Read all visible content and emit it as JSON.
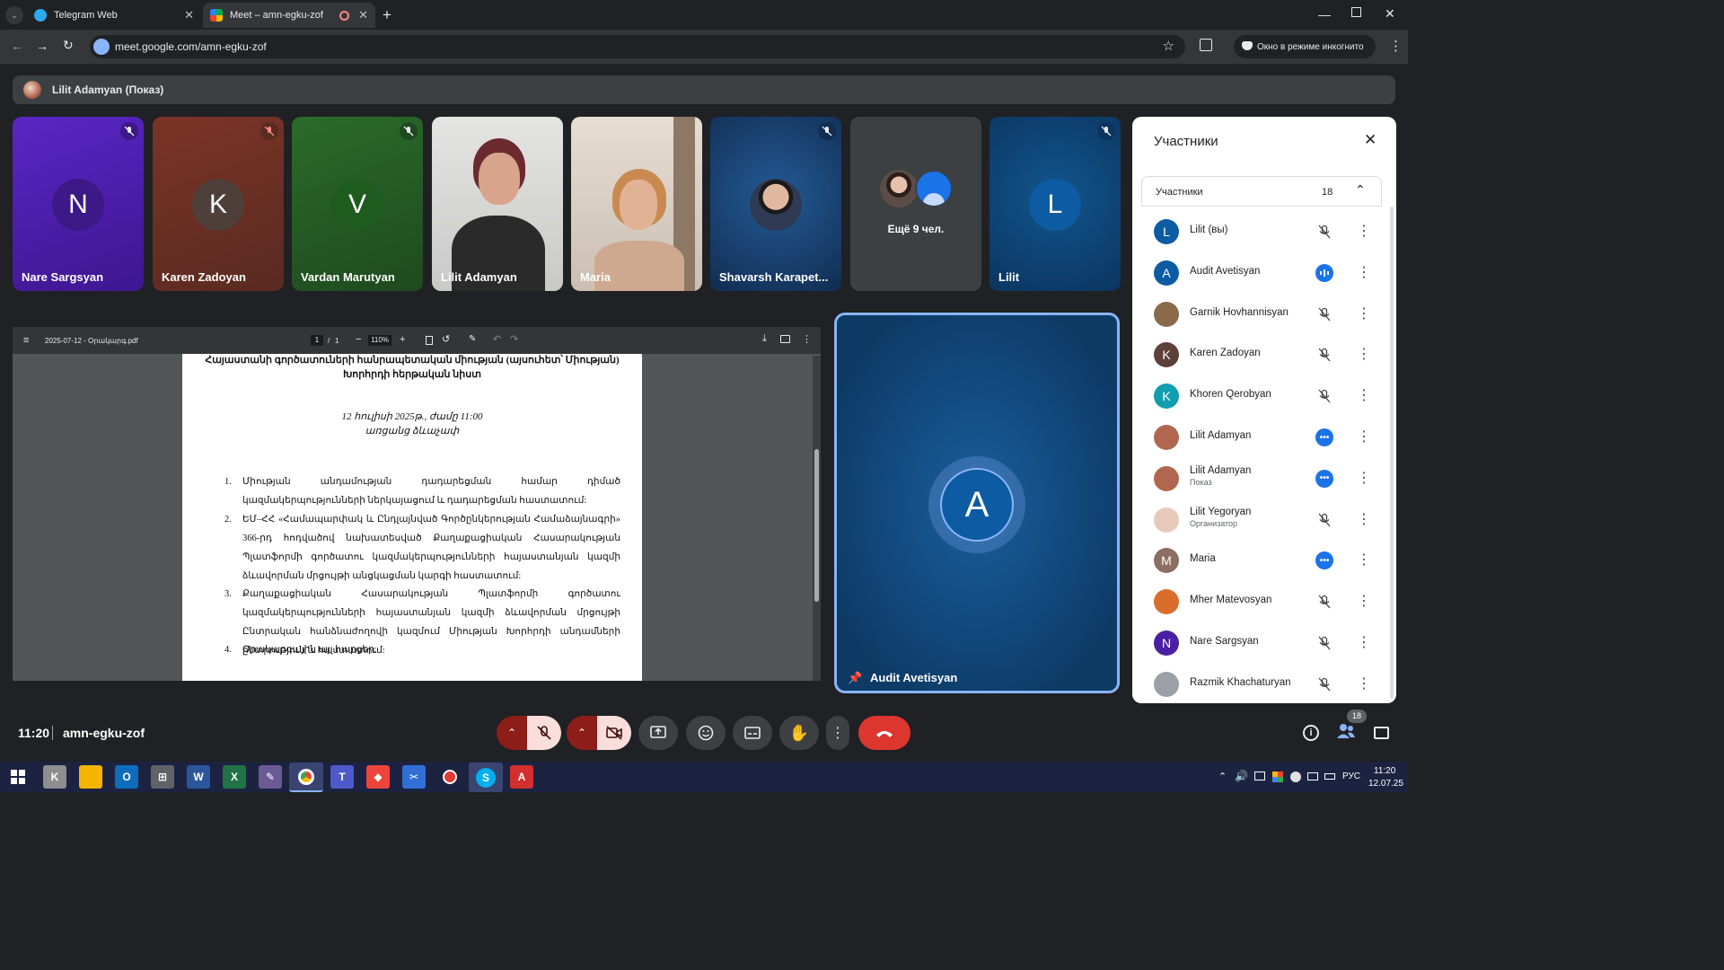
{
  "browser": {
    "tabs": [
      {
        "title": "Telegram Web",
        "active": false,
        "favicon_color": "#2aabee"
      },
      {
        "title": "Meet – amn-egku-zof",
        "active": true,
        "favicon_color": "#00ac47"
      }
    ],
    "url": "meet.google.com/amn-egku-zof",
    "incognito_label": "Окно в режиме инкогнито"
  },
  "meet": {
    "presenting_label": "Lilit Adamyan (Показ)",
    "tiles": [
      {
        "name": "Nare Sargsyan",
        "initial": "N",
        "bg": "#4b1fa3",
        "avatar_bg": "#3d1887",
        "muted": true
      },
      {
        "name": "Karen Zadoyan",
        "initial": "K",
        "bg": "#6b2e23",
        "avatar_bg": "#523c37",
        "muted": true
      },
      {
        "name": "Vardan Marutyan",
        "initial": "V",
        "bg": "#245524",
        "avatar_bg": "#1e5b1e",
        "muted": true
      },
      {
        "name": "Lilit Adamyan",
        "initial": "",
        "bg": "#cfcfcf",
        "avatar_bg": "",
        "muted": false,
        "video": true
      },
      {
        "name": "Maria",
        "initial": "",
        "bg": "#d8ccc2",
        "avatar_bg": "",
        "muted": false,
        "video": true
      },
      {
        "name": "Shavarsh Karapet...",
        "initial": "",
        "bg": "#173a66",
        "avatar_bg": "#2a2f3a",
        "muted": true
      },
      {
        "name": "",
        "initial": "",
        "bg": "#3c4043",
        "avatar_bg": "",
        "muted": false,
        "more": "Ещё 9 чел."
      },
      {
        "name": "Lilit",
        "initial": "L",
        "bg": "#0f4878",
        "avatar_bg": "#0c5ba3",
        "muted": true
      }
    ],
    "pinned": {
      "name": "Audit Avetisyan",
      "initial": "A"
    },
    "time": "11:20",
    "meeting_code": "amn-egku-zof",
    "participant_count": "18"
  },
  "pdf": {
    "filename": "2025-07-12 - Օրակարգ.pdf",
    "page_current": "1",
    "page_total": "1",
    "zoom": "110%",
    "heading_line1": "Հայաստանի գործատուների հանրապետական միության (այսուհետ՝ Միության)",
    "heading_line2": "Խորհրդի հերթական նիստ",
    "date_line": "12 հուլիսի 2025թ., ժամը 11:00",
    "place_line": "առցանց ձևաչափ",
    "items": [
      {
        "num": "1.",
        "text": "Միության անդամության դադարեցման համար դիմած կազմակերպությունների ներկայացում և դադարեցման հաստատում:"
      },
      {
        "num": "2.",
        "text": "ԵՄ–ՀՀ «Համապարփակ և Ընդլայնված Գործընկերության Համաձայնագրի» 366-րդ հոդվածով նախատեսված Քաղաքացիական Հասարակության Պլատֆորմի գործատու կազմակերպությունների հայաստանյան կազմի ձևավորման մրցույթի անցկացման կարգի հաստատում:"
      },
      {
        "num": "3.",
        "text": "Քաղաքացիական Հասարակության Պլատֆորմի գործատու կազմակերպությունների հայաստանյան կազմի ձևավորման մրցույթի Ընտրական հանձնաժողովի կազմում Միության Խորհրդի անդամների ընտրություն և հաստատում:"
      },
      {
        "num": "4.",
        "text": "Օրակարգային այլ հարցեր:"
      }
    ]
  },
  "panel": {
    "title": "Участники",
    "section_label": "Участники",
    "section_count": "18",
    "participants": [
      {
        "name": "Lilit (вы)",
        "sub": "",
        "initial": "L",
        "color": "#0c5ba3",
        "status": "muted"
      },
      {
        "name": "Audit Avetisyan",
        "sub": "",
        "initial": "A",
        "color": "#0c5ba3",
        "status": "speaking"
      },
      {
        "name": "Garnik Hovhannisyan",
        "sub": "",
        "initial": "",
        "color": "#8a6a4a",
        "status": "muted"
      },
      {
        "name": "Karen Zadoyan",
        "sub": "",
        "initial": "K",
        "color": "#5d4037",
        "status": "muted"
      },
      {
        "name": "Khoren Qerobyan",
        "sub": "",
        "initial": "K",
        "color": "#129eaf",
        "status": "muted"
      },
      {
        "name": "Lilit Adamyan",
        "sub": "",
        "initial": "",
        "color": "#b1674f",
        "status": "more"
      },
      {
        "name": "Lilit Adamyan",
        "sub": "Показ",
        "initial": "",
        "color": "#b1674f",
        "status": "more"
      },
      {
        "name": "Lilit Yegoryan",
        "sub": "Организатор",
        "initial": "",
        "color": "#e8c9b9",
        "status": "muted"
      },
      {
        "name": "Maria",
        "sub": "",
        "initial": "M",
        "color": "#8d6e63",
        "status": "more"
      },
      {
        "name": "Mher Matevosyan",
        "sub": "",
        "initial": "",
        "color": "#d86d2c",
        "status": "muted"
      },
      {
        "name": "Nare Sargsyan",
        "sub": "",
        "initial": "N",
        "color": "#4b1fa3",
        "status": "muted"
      },
      {
        "name": "Razmik Khachaturyan",
        "sub": "",
        "initial": "",
        "color": "#9aa0a6",
        "status": "muted"
      }
    ]
  },
  "taskbar": {
    "time": "11:20",
    "date": "12.07.25",
    "lang": "РУС"
  }
}
